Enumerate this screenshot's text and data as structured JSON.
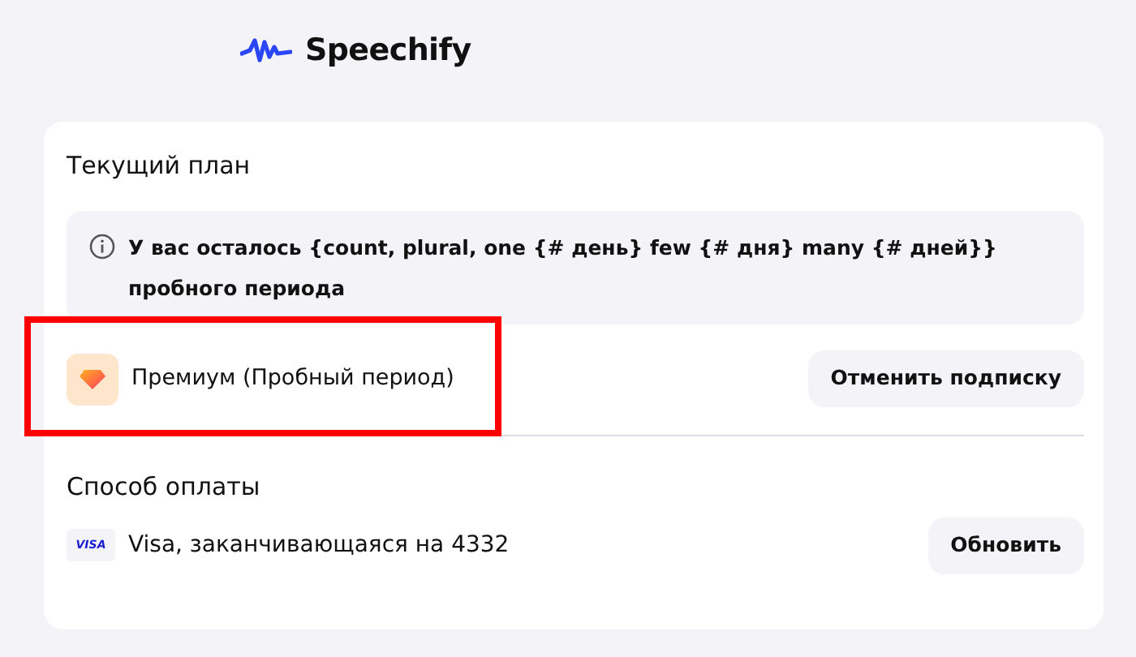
{
  "brand": {
    "name": "Speechify"
  },
  "plan": {
    "title": "Текущий план",
    "notice": "У вас осталось {count, plural, one {# день} few {# дня} many {# дней}} пробного периода",
    "name": "Премиум (Пробный период)",
    "highlighted": true,
    "button": "Отменить подписку"
  },
  "payment": {
    "title": "Способ оплаты",
    "card_brand": "VISA",
    "card_text": "Visa, заканчивающаяся на 4332",
    "button": "Обновить"
  }
}
